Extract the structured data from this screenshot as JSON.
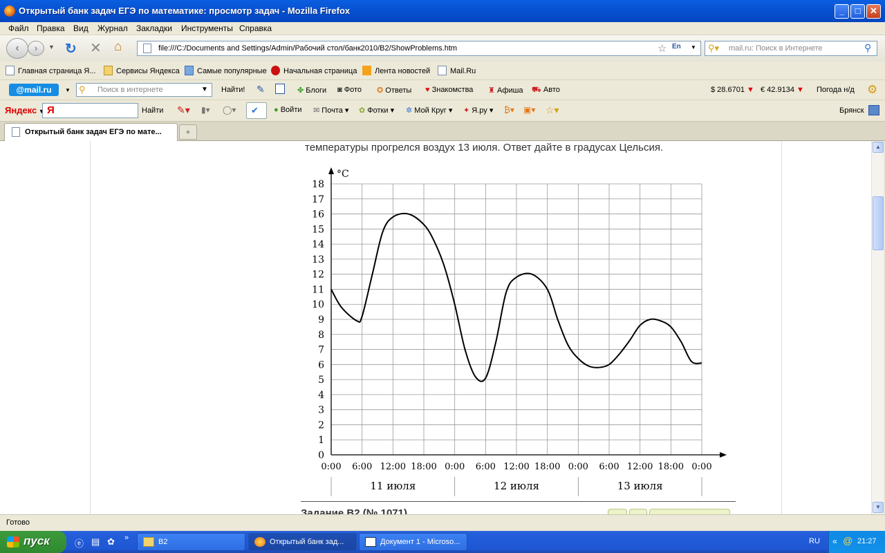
{
  "window": {
    "title": "Открытый банк задач ЕГЭ по математике: просмотр задач - Mozilla Firefox",
    "minimize_icon": "minimize-icon",
    "maximize_icon": "maximize-icon",
    "close_icon": "close-icon"
  },
  "menu": [
    "Файл",
    "Правка",
    "Вид",
    "Журнал",
    "Закладки",
    "Инструменты",
    "Справка"
  ],
  "nav": {
    "url": "file:///C:/Documents and Settings/Admin/Рабочий стол/банк2010/B2/ShowProblems.htm",
    "search_placeholder": "mail.ru: Поиск в Интернете",
    "lang_indicator": "En"
  },
  "bookmarks": [
    "Главная страница Я...",
    "Сервисы Яндекса",
    "Самые популярные",
    "Начальная страница",
    "Лента новостей",
    "Mail.Ru"
  ],
  "mailbar": {
    "logo": "@mail.ru",
    "search_placeholder": "Поиск в интернете",
    "find_label": "Найти!",
    "links": [
      "Блоги",
      "Фото",
      "Ответы",
      "Знакомства",
      "Афиша",
      "Авто"
    ],
    "usd": "$ 28.6701",
    "eur": "€ 42.9134",
    "weather": "Погода н/д"
  },
  "yandexbar": {
    "logo": "Яндекс",
    "find_label": "Найти",
    "links": [
      "Войти",
      "Почта",
      "Фотки",
      "Мой Круг",
      "Я.ру"
    ],
    "city": "Брянск"
  },
  "tab": {
    "label": "Открытый банк задач ЕГЭ по мате...",
    "new_tab": "+"
  },
  "content": {
    "problem_text": "температуры прогрелся воздух 13 июля. Ответ дайте в градусах Цельсия.",
    "next_heading": "Задание B2 (№ 1071)"
  },
  "status": {
    "text": "Готово"
  },
  "taskbar": {
    "start_label": "пуск",
    "tasks": [
      "B2",
      "Открытый банк зад...",
      "Документ 1 - Microso..."
    ],
    "lang": "RU",
    "clock": "21:27"
  },
  "chart_data": {
    "type": "line",
    "ylabel": "°C",
    "xlabel": "",
    "title": "",
    "ylim": [
      0,
      18
    ],
    "xlim": [
      0,
      72
    ],
    "x_tick_labels": [
      "0:00",
      "6:00",
      "12:00",
      "18:00",
      "0:00",
      "6:00",
      "12:00",
      "18:00",
      "0:00",
      "6:00",
      "12:00",
      "18:00",
      "0:00"
    ],
    "y_ticks": [
      0,
      1,
      2,
      3,
      4,
      5,
      6,
      7,
      8,
      9,
      10,
      11,
      12,
      13,
      14,
      15,
      16,
      17,
      18
    ],
    "day_labels": [
      "11 июля",
      "12 июля",
      "13 июля"
    ],
    "grid": true,
    "series": [
      {
        "x": [
          0,
          2,
          5,
          6,
          8,
          10,
          12,
          15,
          18,
          20,
          22,
          24,
          26,
          28,
          30,
          32,
          34,
          36,
          39,
          42,
          44,
          46,
          48,
          50,
          52,
          54,
          56,
          58,
          60,
          62,
          64,
          66,
          68,
          70,
          72
        ],
        "y": [
          11,
          9.8,
          8.9,
          9.2,
          12,
          14.8,
          15.8,
          16,
          15.3,
          14.2,
          12.5,
          10,
          7,
          5.2,
          5.1,
          7.5,
          10.8,
          11.8,
          12,
          11,
          9,
          7.3,
          6.4,
          5.9,
          5.8,
          6,
          6.7,
          7.6,
          8.6,
          9,
          8.9,
          8.5,
          7.5,
          6.2,
          6.1
        ]
      }
    ]
  }
}
